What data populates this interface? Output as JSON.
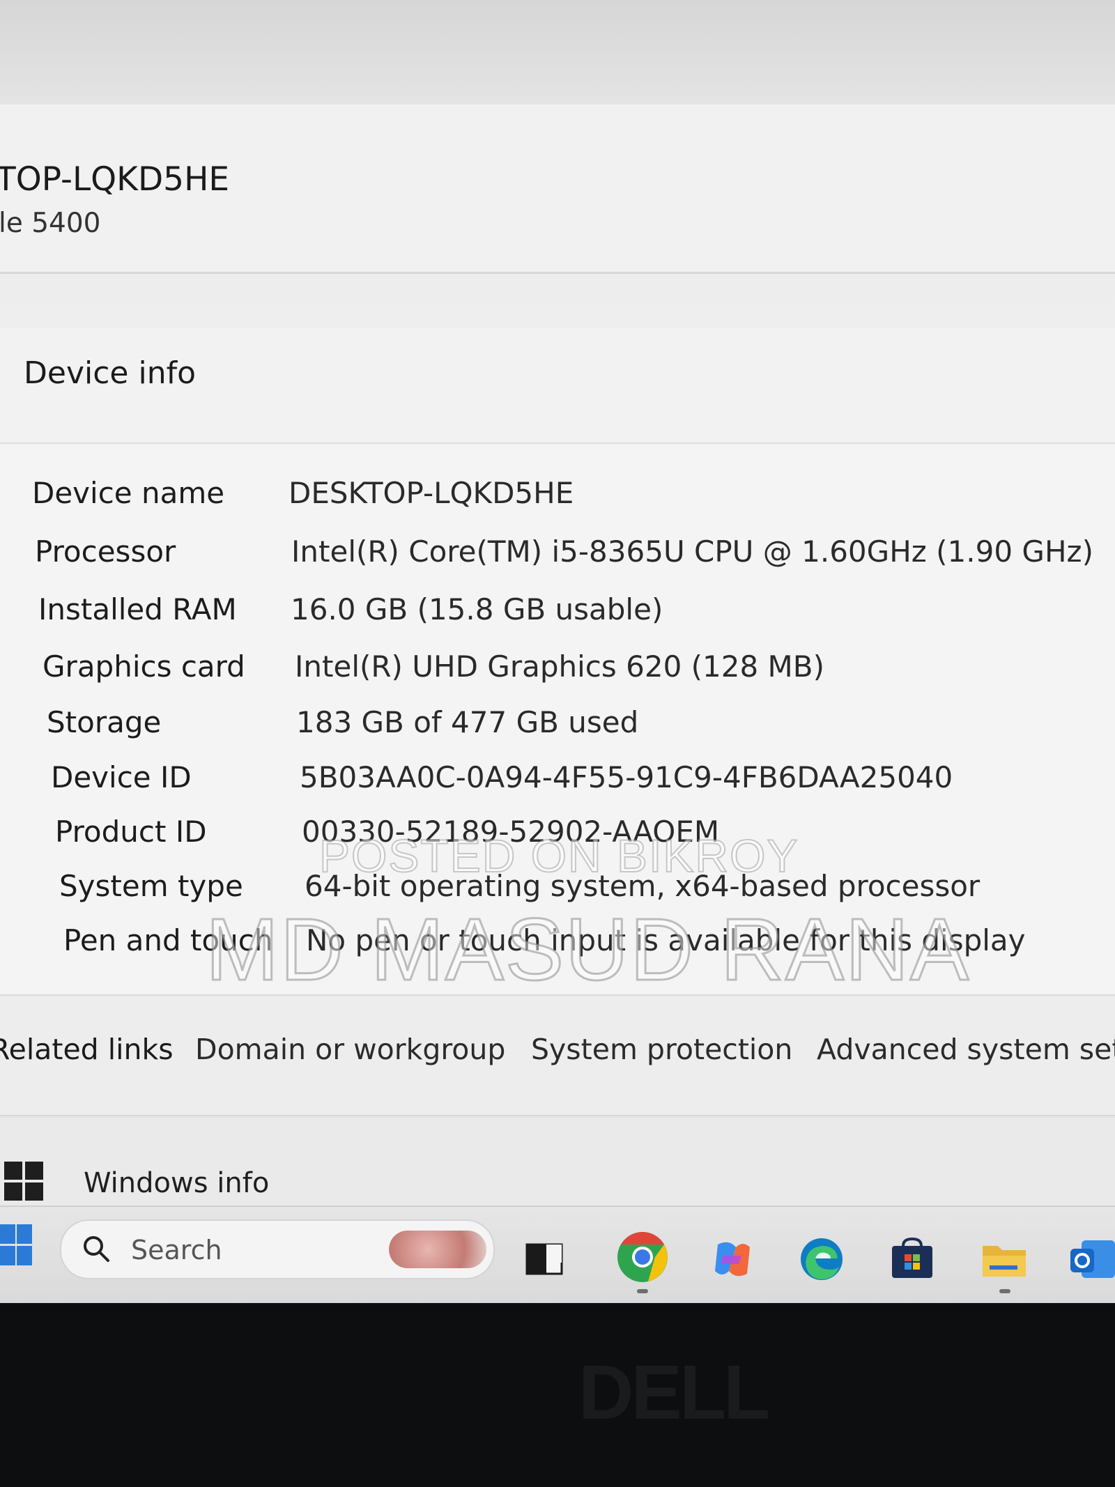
{
  "header": {
    "device_title": "TOP-LQKD5HE",
    "device_model": "le 5400"
  },
  "device_info": {
    "title": "Device info",
    "rows": [
      {
        "label": "Device name",
        "value": "DESKTOP-LQKD5HE"
      },
      {
        "label": "Processor",
        "value": "Intel(R) Core(TM) i5-8365U CPU @ 1.60GHz (1.90 GHz)"
      },
      {
        "label": "Installed RAM",
        "value": "16.0 GB (15.8 GB usable)"
      },
      {
        "label": "Graphics card",
        "value": "Intel(R) UHD Graphics 620 (128 MB)"
      },
      {
        "label": "Storage",
        "value": "183 GB of 477 GB used"
      },
      {
        "label": "Device ID",
        "value": "5B03AA0C-0A94-4F55-91C9-4FB6DAA25040"
      },
      {
        "label": "Product ID",
        "value": "00330-52189-52902-AAOEM"
      },
      {
        "label": "System type",
        "value": "64-bit operating system, x64-based processor"
      },
      {
        "label": "Pen and touch",
        "value": "No pen or touch input is available for this display"
      }
    ]
  },
  "related_links": {
    "title": "Related links",
    "links": [
      "Domain or workgroup",
      "System protection",
      "Advanced system setti"
    ]
  },
  "windows_info": {
    "label": "Windows info",
    "icon": "windows-logo-icon"
  },
  "taskbar": {
    "search_placeholder": "Search",
    "icons": [
      "start-icon",
      "task-view-icon",
      "chrome-icon",
      "copilot-icon",
      "edge-icon",
      "store-icon",
      "file-explorer-icon",
      "outlook-icon"
    ],
    "colors": {
      "start": "#2b7bd6",
      "chrome_red": "#e0453a",
      "chrome_yellow": "#f4c20d",
      "chrome_green": "#2ea44f",
      "edge": "#0f7dc4",
      "folder": "#e8b43c"
    }
  },
  "bezel": {
    "brand": "DELL"
  },
  "watermark": {
    "line1": "POSTED ON BIKROY",
    "line2": "MD MASUD RANA"
  }
}
